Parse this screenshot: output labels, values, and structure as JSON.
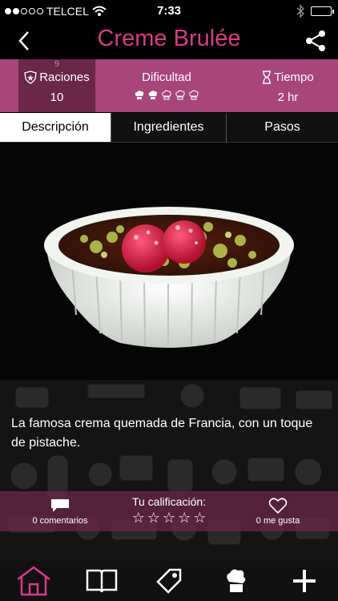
{
  "status": {
    "carrier": "TELCEL",
    "time": "7:33"
  },
  "header": {
    "title": "Creme Brulée"
  },
  "info": {
    "raciones_top": "9",
    "raciones_label": "Raciones",
    "raciones_value": "10",
    "dificultad_label": "Dificultad",
    "dificultad_level": 2,
    "dificultad_max": 5,
    "tiempo_label": "Tiempo",
    "tiempo_value": "2 hr"
  },
  "tabs": [
    {
      "label": "Descripción",
      "active": true
    },
    {
      "label": "Ingredientes",
      "active": false
    },
    {
      "label": "Pasos",
      "active": false
    }
  ],
  "description": "La famosa crema quemada de Francia, con un toque de pistache.",
  "social": {
    "comments": "0 comentarios",
    "rating_label": "Tu calificación:",
    "rating_value": 0,
    "rating_max": 5,
    "likes": "0 me gusta"
  },
  "colors": {
    "accent": "#d93a8a",
    "band": "#a8457b",
    "band_dark": "#6b2748"
  },
  "nav": {
    "items": [
      "home-icon",
      "book-icon",
      "tag-icon",
      "chef-hat-icon",
      "plus-icon"
    ],
    "active": "home-icon"
  }
}
